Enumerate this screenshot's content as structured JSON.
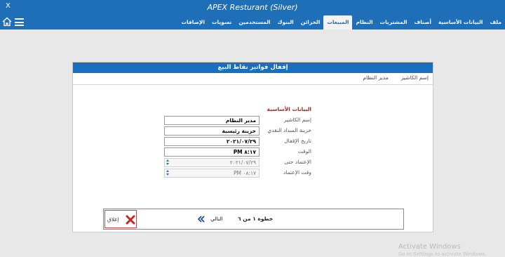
{
  "window": {
    "title": "APEX Resturant (Silver)",
    "close_glyph": "X"
  },
  "menu": {
    "items": [
      {
        "label": "ملف",
        "active": false
      },
      {
        "label": "البيانات الأساسية",
        "active": false
      },
      {
        "label": "أصناف",
        "active": false
      },
      {
        "label": "المشتريات",
        "active": false
      },
      {
        "label": "النظام",
        "active": false
      },
      {
        "label": "المبيعات",
        "active": true
      },
      {
        "label": "الخزائن",
        "active": false
      },
      {
        "label": "البنوك",
        "active": false
      },
      {
        "label": "المستخدمين",
        "active": false
      },
      {
        "label": "تسويات",
        "active": false
      },
      {
        "label": "الإضافات",
        "active": false
      }
    ],
    "icons": [
      "home-icon",
      "hamburger-menu-icon"
    ]
  },
  "dialog": {
    "title": "إقفال فواتير نقاط البيع",
    "user_label": "إسم الكاشير",
    "user_value": "مدير النظام",
    "section_title": "البيانات الأساسية",
    "fields": [
      {
        "label": "إسم الكاشير",
        "value": "مدير النظام",
        "enabled": true
      },
      {
        "label": "خزينة السداد النقدي",
        "value": "خزينة رئيسية",
        "enabled": true
      },
      {
        "label": "تاريخ الإقفال",
        "value": "٢٠٢١/٠٧/٢٩",
        "enabled": true
      },
      {
        "label": "الوقت",
        "value": "PM ٨:١٧",
        "enabled": true
      },
      {
        "label": "الإعتماد حتى",
        "value": "٢٠٢١/٠٧/٢٩",
        "enabled": false
      },
      {
        "label": "وقت الإعتماد",
        "value": "PM ٠٨:١٧",
        "enabled": false
      }
    ]
  },
  "footer": {
    "close_label": "إغلاق",
    "step_text": "خطوة ١ من ٦",
    "next_label": "التالي",
    "colors": {
      "close_border": "#c64848",
      "close_icon": "#c62828"
    }
  },
  "watermark": {
    "line1": "Activate Windows",
    "line2": "Go to Settings to activate Windows."
  },
  "colors": {
    "title_bar": "#1f6fb8",
    "dialog_header": "#1a6ebd",
    "section_title": "#b02222"
  }
}
